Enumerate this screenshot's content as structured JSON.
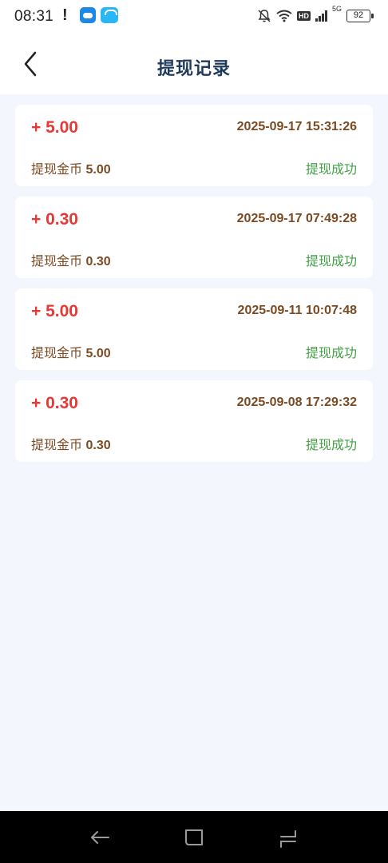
{
  "status_bar": {
    "time": "08:31",
    "battery": "92",
    "network": "5G"
  },
  "header": {
    "title": "提现记录"
  },
  "records": [
    {
      "amount": "+ 5.00",
      "time": "2025-09-17 15:31:26",
      "coins_label": "提现金币",
      "coins_value": "5.00",
      "status": "提现成功"
    },
    {
      "amount": "+ 0.30",
      "time": "2025-09-17 07:49:28",
      "coins_label": "提现金币",
      "coins_value": "0.30",
      "status": "提现成功"
    },
    {
      "amount": "+ 5.00",
      "time": "2025-09-11 10:07:48",
      "coins_label": "提现金币",
      "coins_value": "5.00",
      "status": "提现成功"
    },
    {
      "amount": "+ 0.30",
      "time": "2025-09-08 17:29:32",
      "coins_label": "提现金币",
      "coins_value": "0.30",
      "status": "提现成功"
    }
  ],
  "colors": {
    "amount": "#e53935",
    "success": "#43a047",
    "detail": "#7b4a22",
    "title": "#1f3a5c",
    "background": "#f3f6fd"
  },
  "icons": {
    "back": "chevron-left-icon",
    "nav_back": "nav-back-icon",
    "nav_home": "nav-home-icon",
    "nav_recents": "nav-recents-icon"
  }
}
